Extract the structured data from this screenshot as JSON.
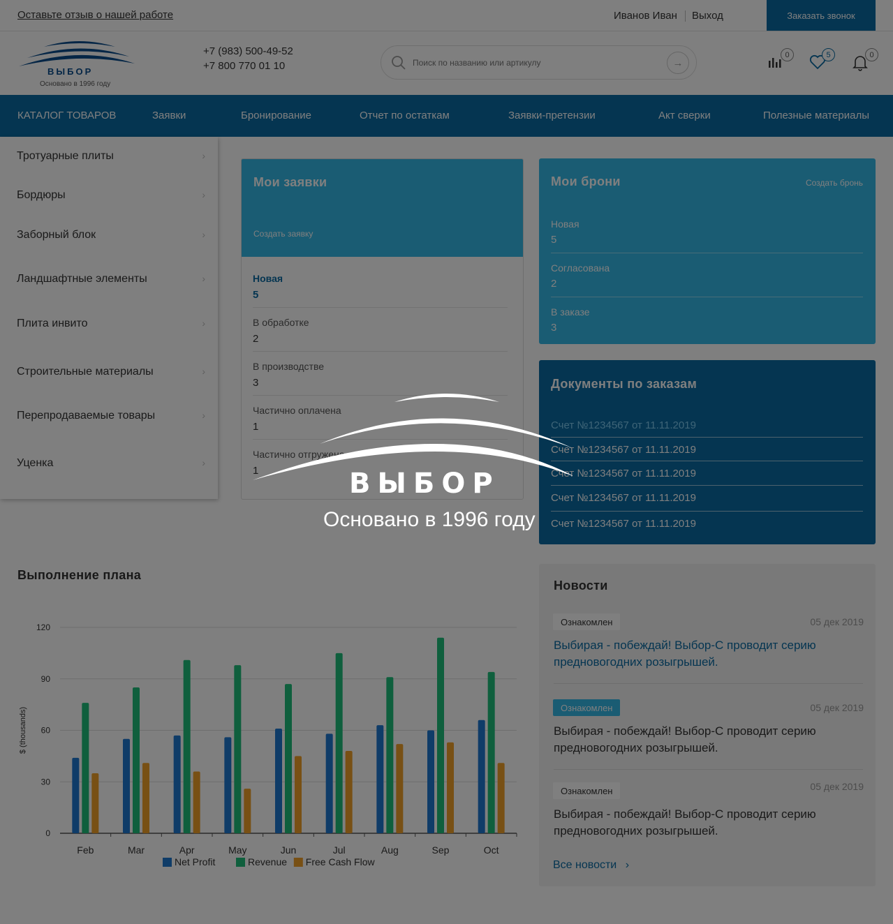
{
  "topbar": {
    "review_link": "Оставьте отзыв о нашей работе",
    "user_name": "Иванов Иван",
    "logout": "Выход",
    "callback_button": "Заказать звонок"
  },
  "header": {
    "logo_text": "ВЫБОР",
    "logo_subtitle": "Основано в 1996 году",
    "phones": [
      "+7 (983) 500-49-52",
      "+7 800 770 01 10"
    ],
    "search_placeholder": "Поиск по названию или артикулу",
    "compare_count": "0",
    "favorites_count": "5",
    "notifications_count": "0"
  },
  "nav": {
    "items": [
      "КАТАЛОГ ТОВАРОВ",
      "Заявки",
      "Бронирование",
      "Отчет по остаткам",
      "Заявки-претензии",
      "Акт сверки",
      "Полезные материалы"
    ]
  },
  "catalog": {
    "items": [
      "Тротуарные плиты",
      "Бордюры",
      "Заборный блок",
      "Ландшафтные элементы",
      "Плита инвито",
      "Строительные материалы",
      "Перепродаваемые товары",
      "Уценка"
    ]
  },
  "orders": {
    "title": "Мои заявки",
    "create_link": "Создать заявку",
    "statuses": [
      {
        "label": "Новая",
        "value": "5"
      },
      {
        "label": "В обработке",
        "value": "2"
      },
      {
        "label": "В производстве",
        "value": "3"
      },
      {
        "label": "Частично оплачена",
        "value": "1"
      },
      {
        "label": "Частично отгружена",
        "value": "1"
      }
    ]
  },
  "bookings": {
    "title": "Мои брони",
    "create_link": "Создать бронь",
    "statuses": [
      {
        "label": "Новая",
        "value": "5"
      },
      {
        "label": "Согласована",
        "value": "2"
      },
      {
        "label": "В заказе",
        "value": "3"
      }
    ]
  },
  "documents": {
    "title": "Документы по заказам",
    "items": [
      "Счет №1234567 от 11.11.2019",
      "Счет №1234567 от 11.11.2019",
      "Счет №1234567 от 11.11.2019",
      "Счет №1234567 от 11.11.2019",
      "Счет №1234567 от 11.11.2019"
    ]
  },
  "plan": {
    "title": "Выполнение плана"
  },
  "chart_data": {
    "type": "bar",
    "title": "",
    "xlabel": "",
    "ylabel": "$ (thousands)",
    "ylim": [
      0,
      120
    ],
    "yticks": [
      0,
      30,
      60,
      90,
      120
    ],
    "categories": [
      "Feb",
      "Mar",
      "Apr",
      "May",
      "Jun",
      "Jul",
      "Aug",
      "Sep",
      "Oct"
    ],
    "series": [
      {
        "name": "Net Profit",
        "color": "#1f78d1",
        "values": [
          44,
          55,
          57,
          56,
          61,
          58,
          63,
          60,
          66
        ]
      },
      {
        "name": "Revenue",
        "color": "#1fbf7a",
        "values": [
          76,
          85,
          101,
          98,
          87,
          105,
          91,
          114,
          94
        ]
      },
      {
        "name": "Free Cash Flow",
        "color": "#f0a028",
        "values": [
          35,
          41,
          36,
          26,
          45,
          48,
          52,
          53,
          41
        ]
      }
    ],
    "grid": true,
    "legend_position": "bottom"
  },
  "news": {
    "title": "Новости",
    "items": [
      {
        "badge": "Ознакомлен",
        "date": "05 дек 2019",
        "text": "Выбирая - побеждай! Выбор-С проводит серию предновогодних розыгрышей."
      },
      {
        "badge": "Ознакомлен",
        "date": "05 дек 2019",
        "text": "Выбирая - побеждай! Выбор-С проводит серию предновогодних розыгрышей."
      },
      {
        "badge": "Ознакомлен",
        "date": "05 дек 2019",
        "text": "Выбирая - побеждай! Выбор-С проводит серию предновогодних розыгрышей."
      }
    ],
    "all_link": "Все новости",
    "all_link_icon": "chevron-right-icon"
  },
  "splash": {
    "logo_text": "ВЫБОР",
    "subtitle": "Основано в 1996 году"
  },
  "colors": {
    "brand": "#0a6ba3",
    "accent": "#35b8e6",
    "overlay": "rgba(0,0,0,0.5)"
  }
}
